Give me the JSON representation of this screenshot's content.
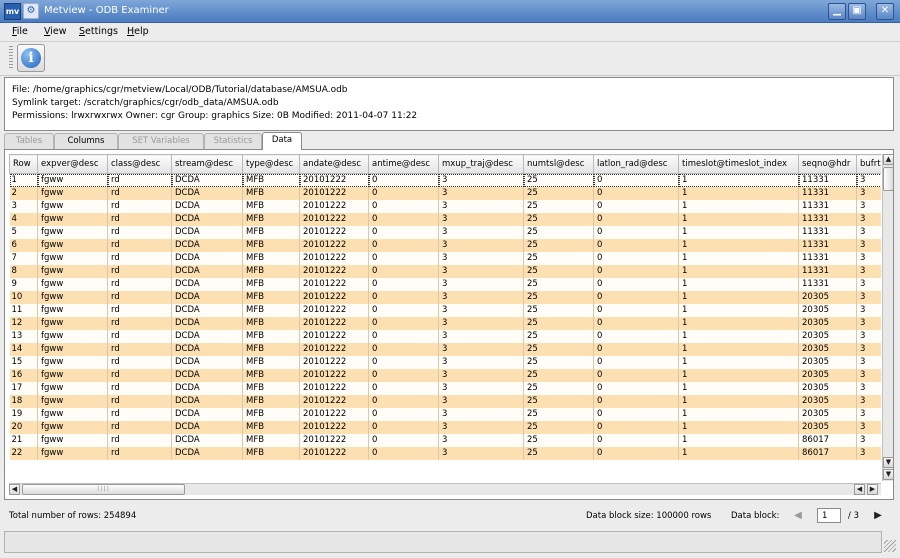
{
  "window": {
    "app_icon": "mv",
    "title": "Metview - ODB Examiner",
    "buttons": {
      "minimize": "▁",
      "maximize": "▣",
      "close": "✕"
    }
  },
  "menu": [
    "File",
    "View",
    "Settings",
    "Help"
  ],
  "toolbar": {
    "info_icon": "i"
  },
  "info": {
    "file": "File: /home/graphics/cgr/metview/Local/ODB/Tutorial/database/AMSUA.odb",
    "symlink": "Symlink target: /scratch/graphics/cgr/odb_data/AMSUA.odb",
    "permissions": "Permissions: lrwxrwxrwx Owner: cgr Group: graphics Size: 0B Modified: 2011-04-07 11:22"
  },
  "tabs": [
    {
      "label": "Tables",
      "state": "disabled"
    },
    {
      "label": "Columns",
      "state": "enabled"
    },
    {
      "label": "SET Variables",
      "state": "disabled"
    },
    {
      "label": "Statistics",
      "state": "disabled"
    },
    {
      "label": "Data",
      "state": "active"
    }
  ],
  "table": {
    "columns": [
      "Row",
      "expver@desc",
      "class@desc",
      "stream@desc",
      "type@desc",
      "andate@desc",
      "antime@desc",
      "mxup_traj@desc",
      "numtsl@desc",
      "latlon_rad@desc",
      "timeslot@timeslot_index",
      "seqno@hdr",
      "bufrtype@hdr"
    ],
    "rows": [
      [
        "1",
        "fgww",
        "rd",
        "DCDA",
        "MFB",
        "20101222",
        "0",
        "3",
        "25",
        "0",
        "1",
        "11331",
        "3"
      ],
      [
        "2",
        "fgww",
        "rd",
        "DCDA",
        "MFB",
        "20101222",
        "0",
        "3",
        "25",
        "0",
        "1",
        "11331",
        "3"
      ],
      [
        "3",
        "fgww",
        "rd",
        "DCDA",
        "MFB",
        "20101222",
        "0",
        "3",
        "25",
        "0",
        "1",
        "11331",
        "3"
      ],
      [
        "4",
        "fgww",
        "rd",
        "DCDA",
        "MFB",
        "20101222",
        "0",
        "3",
        "25",
        "0",
        "1",
        "11331",
        "3"
      ],
      [
        "5",
        "fgww",
        "rd",
        "DCDA",
        "MFB",
        "20101222",
        "0",
        "3",
        "25",
        "0",
        "1",
        "11331",
        "3"
      ],
      [
        "6",
        "fgww",
        "rd",
        "DCDA",
        "MFB",
        "20101222",
        "0",
        "3",
        "25",
        "0",
        "1",
        "11331",
        "3"
      ],
      [
        "7",
        "fgww",
        "rd",
        "DCDA",
        "MFB",
        "20101222",
        "0",
        "3",
        "25",
        "0",
        "1",
        "11331",
        "3"
      ],
      [
        "8",
        "fgww",
        "rd",
        "DCDA",
        "MFB",
        "20101222",
        "0",
        "3",
        "25",
        "0",
        "1",
        "11331",
        "3"
      ],
      [
        "9",
        "fgww",
        "rd",
        "DCDA",
        "MFB",
        "20101222",
        "0",
        "3",
        "25",
        "0",
        "1",
        "11331",
        "3"
      ],
      [
        "10",
        "fgww",
        "rd",
        "DCDA",
        "MFB",
        "20101222",
        "0",
        "3",
        "25",
        "0",
        "1",
        "20305",
        "3"
      ],
      [
        "11",
        "fgww",
        "rd",
        "DCDA",
        "MFB",
        "20101222",
        "0",
        "3",
        "25",
        "0",
        "1",
        "20305",
        "3"
      ],
      [
        "12",
        "fgww",
        "rd",
        "DCDA",
        "MFB",
        "20101222",
        "0",
        "3",
        "25",
        "0",
        "1",
        "20305",
        "3"
      ],
      [
        "13",
        "fgww",
        "rd",
        "DCDA",
        "MFB",
        "20101222",
        "0",
        "3",
        "25",
        "0",
        "1",
        "20305",
        "3"
      ],
      [
        "14",
        "fgww",
        "rd",
        "DCDA",
        "MFB",
        "20101222",
        "0",
        "3",
        "25",
        "0",
        "1",
        "20305",
        "3"
      ],
      [
        "15",
        "fgww",
        "rd",
        "DCDA",
        "MFB",
        "20101222",
        "0",
        "3",
        "25",
        "0",
        "1",
        "20305",
        "3"
      ],
      [
        "16",
        "fgww",
        "rd",
        "DCDA",
        "MFB",
        "20101222",
        "0",
        "3",
        "25",
        "0",
        "1",
        "20305",
        "3"
      ],
      [
        "17",
        "fgww",
        "rd",
        "DCDA",
        "MFB",
        "20101222",
        "0",
        "3",
        "25",
        "0",
        "1",
        "20305",
        "3"
      ],
      [
        "18",
        "fgww",
        "rd",
        "DCDA",
        "MFB",
        "20101222",
        "0",
        "3",
        "25",
        "0",
        "1",
        "20305",
        "3"
      ],
      [
        "19",
        "fgww",
        "rd",
        "DCDA",
        "MFB",
        "20101222",
        "0",
        "3",
        "25",
        "0",
        "1",
        "20305",
        "3"
      ],
      [
        "20",
        "fgww",
        "rd",
        "DCDA",
        "MFB",
        "20101222",
        "0",
        "3",
        "25",
        "0",
        "1",
        "20305",
        "3"
      ],
      [
        "21",
        "fgww",
        "rd",
        "DCDA",
        "MFB",
        "20101222",
        "0",
        "3",
        "25",
        "0",
        "1",
        "86017",
        "3"
      ],
      [
        "22",
        "fgww",
        "rd",
        "DCDA",
        "MFB",
        "20101222",
        "0",
        "3",
        "25",
        "0",
        "1",
        "86017",
        "3"
      ]
    ],
    "selected_row": 0
  },
  "scroll": {
    "up": "▲",
    "down": "▼",
    "left": "◀",
    "right": "▶",
    "grip": "⁞⁞⁞⁞"
  },
  "footer": {
    "total_rows": "Total number of rows: 254894",
    "block_size": "Data block size: 100000 rows",
    "block_label": "Data block:",
    "block_value": "1",
    "block_total": "/ 3",
    "prev": "◀",
    "next": "▶"
  },
  "colors": {
    "row_odd": "#fffdf8",
    "row_even": "#fde0b2",
    "title_bar": "#4a7cc0"
  }
}
